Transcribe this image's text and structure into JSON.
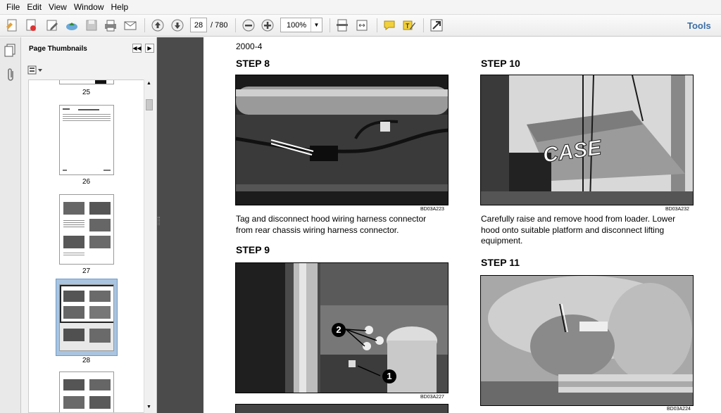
{
  "menu": [
    "File",
    "Edit",
    "View",
    "Window",
    "Help"
  ],
  "toolbar": {
    "current_page": "28",
    "total_pages": "/ 780",
    "zoom": "100%",
    "tools_label": "Tools"
  },
  "thumbnails": {
    "title": "Page Thumbnails",
    "pages": [
      "25",
      "26",
      "27",
      "28"
    ]
  },
  "document": {
    "section_number": "2000-4",
    "steps": [
      {
        "heading": "STEP 8",
        "code": "BD03A223",
        "text": [
          "Tag and disconnect hood wiring harness connector",
          "from rear chassis wiring harness connector."
        ]
      },
      {
        "heading": "STEP 9",
        "code": "BD03A227",
        "callouts": [
          "2",
          "1"
        ]
      },
      {
        "heading": "STEP 10",
        "code": "BD03A232",
        "brand": "CASE",
        "text": [
          "Carefully raise and remove hood from loader. Lower",
          "hood onto suitable platform and disconnect lifting",
          "equipment."
        ]
      },
      {
        "heading": "STEP 11",
        "code": "BD03A224"
      }
    ]
  }
}
